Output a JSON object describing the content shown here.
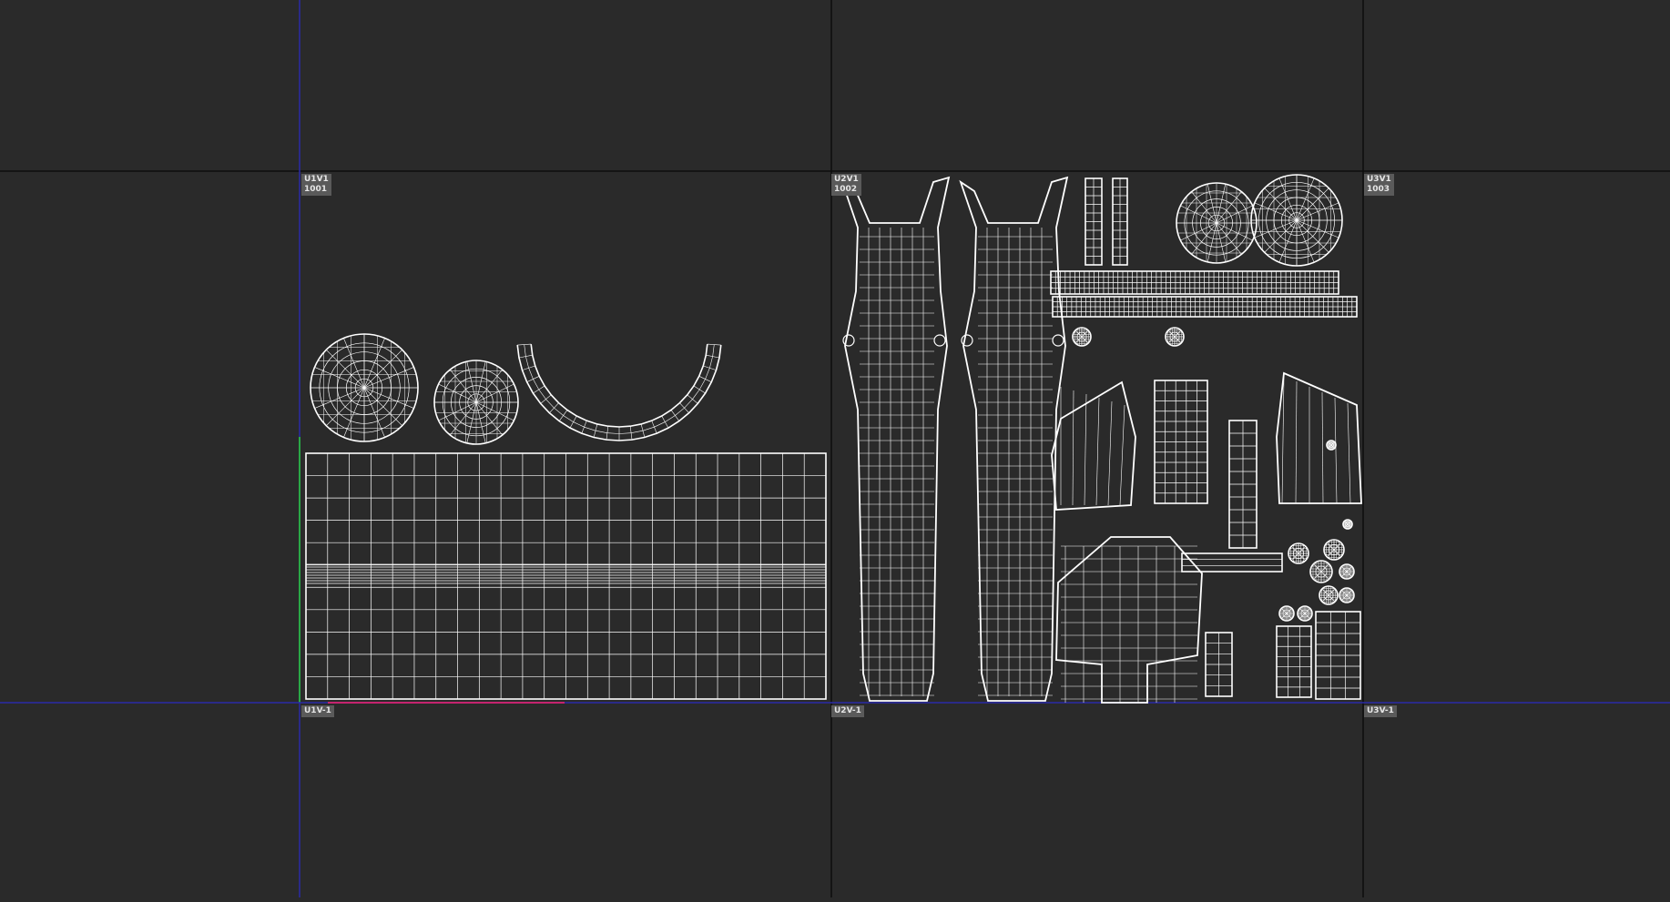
{
  "viewport": {
    "background": "#2a2a2a",
    "grid_line_color": "#0c0c0c",
    "u_axis_color": "#2a2aa8",
    "v_axis_color": "#2a2aa8",
    "v_axis_highlight_color": "#2bd13a",
    "u_axis_highlight_color": "#c5246f",
    "wire_color": "#ffffff"
  },
  "tiles": {
    "u1v1": {
      "label": "U1V1\n1001"
    },
    "u2v1": {
      "label": "U2V1\n1002"
    },
    "u3v1": {
      "label": "U3V1\n1003"
    },
    "u1vm1": {
      "label": "U1V-1"
    },
    "u2vm1": {
      "label": "U2V-1"
    },
    "u3vm1": {
      "label": "U3V-1"
    }
  }
}
